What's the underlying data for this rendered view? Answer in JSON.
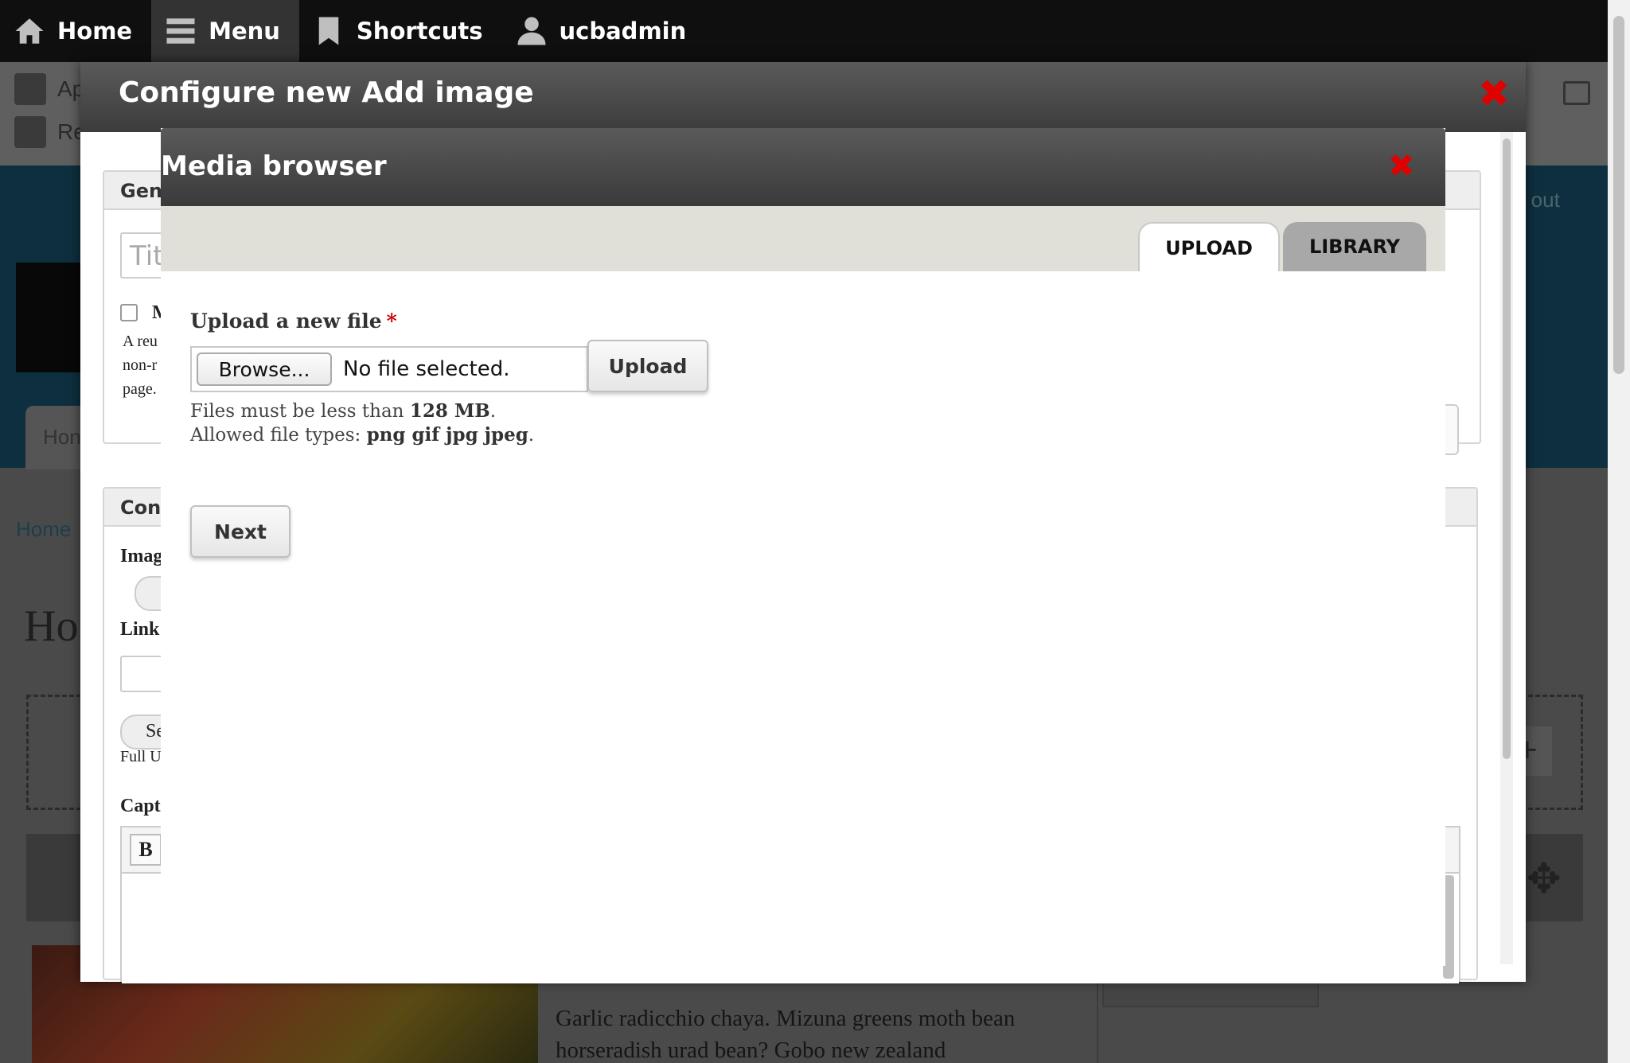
{
  "toolbar": {
    "items": [
      {
        "label": "Home",
        "icon": "home-icon"
      },
      {
        "label": "Menu",
        "icon": "menu-icon"
      },
      {
        "label": "Shortcuts",
        "icon": "bookmark-icon"
      },
      {
        "label": "ucbadmin",
        "icon": "user-icon"
      }
    ]
  },
  "tray": {
    "row1": "Ap",
    "row2": "Re"
  },
  "background": {
    "logout": "g out",
    "tab": "Hon",
    "breadcrumb": "Home",
    "title": "Ho",
    "dash_text": "Co",
    "paragraph_line1": "Garlic radicchio chaya. Mizuna greens moth bean",
    "paragraph_line2": "horseradish urad bean? Gobo new zealand"
  },
  "configure_dialog": {
    "title": "Configure new Add image",
    "close": "✖",
    "general_legend": "Gene",
    "title_placeholder": "Tit",
    "checkbox_label": "M",
    "help_line1": "A reu",
    "help_line2": "non-r",
    "help_line3": "page.",
    "content_legend": "Cont",
    "image_label": "Imag",
    "link_label": "Link",
    "select_btn": "Se",
    "full_url": "Full U",
    "caption_label": "Capt",
    "bold_btn": "B"
  },
  "media_browser": {
    "title": "Media browser",
    "close": "✖",
    "tabs": [
      "UPLOAD",
      "LIBRARY"
    ],
    "upload_label": "Upload a new file",
    "required_mark": "*",
    "browse_label": "Browse...",
    "file_status": "No file selected.",
    "upload_button": "Upload",
    "size_prefix": "Files must be less than ",
    "size_value": "128 MB",
    "size_suffix": ".",
    "types_prefix": "Allowed file types: ",
    "types_value": "png gif jpg jpeg",
    "types_suffix": ".",
    "next_button": "Next"
  },
  "colors": {
    "toolbar_bg": "#0f0f0f",
    "close_red": "#e00000",
    "required_red": "#cc0000",
    "tabs_bar": "#e0e0d8"
  }
}
